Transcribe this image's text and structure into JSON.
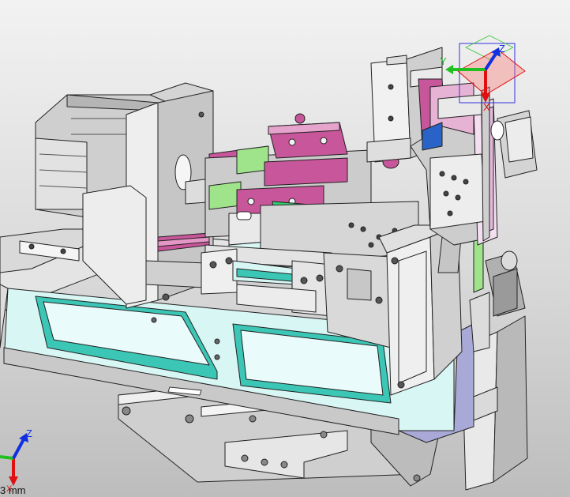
{
  "viewport": {
    "scale_bar": {
      "value": "3 mm"
    },
    "triad": {
      "x": "X",
      "y": "Y",
      "z": "Z"
    },
    "colors": {
      "background_top": "#f2f2f2",
      "background_bottom": "#bdbdbd",
      "metal": "#d6d6d6",
      "metal_dark": "#8c8c8c",
      "cyan": "#3cc6b6",
      "pale_cyan": "#d8f6f4",
      "magenta": "#c8569a",
      "light_green": "#9fe38b",
      "bright_green": "#2fd06d",
      "blue": "#2a63c7",
      "axis_x": "#e01010",
      "axis_y": "#20c020",
      "axis_z": "#1030e0"
    }
  }
}
